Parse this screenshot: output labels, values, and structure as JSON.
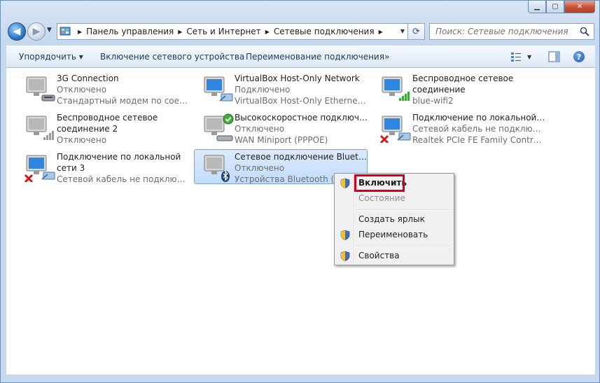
{
  "address": {
    "crumbs": [
      "Панель управления",
      "Сеть и Интернет",
      "Сетевые подключения"
    ]
  },
  "search": {
    "placeholder": "Поиск: Сетевые подключения"
  },
  "toolbar": {
    "organize": "Упорядочить ▾",
    "enable_device": "Включение сетевого устройства",
    "rename": "Переименование подключения",
    "more": "»"
  },
  "connections": [
    {
      "name": "3G Connection",
      "status": "Отключено",
      "device": "Стандартный модем по соедине..."
    },
    {
      "name": "VirtualBox Host-Only Network",
      "status": "Подключено",
      "device": "VirtualBox Host-Only Ethernet Ad..."
    },
    {
      "name": "Беспроводное сетевое соединение",
      "status": "",
      "device": "blue-wifi2"
    },
    {
      "name": "Беспроводное сетевое соединение 2",
      "status": "Отключено",
      "device": ""
    },
    {
      "name": "Высокоскоростное подключение",
      "status": "Отключено",
      "device": "WAN Miniport (PPPOE)"
    },
    {
      "name": "Подключение по локальной сети",
      "status": "Сетевой кабель не подключен",
      "device": "Realtek PCIe FE Family Controller"
    },
    {
      "name": "Подключение по локальной сети 3",
      "status": "",
      "device": "Сетевой кабель не подключен"
    },
    {
      "name": "Сетевое подключение Bluetooth",
      "status": "Отключено",
      "device": "Устройства Bluetooth (лич..."
    }
  ],
  "context_menu": {
    "enable": "Включить",
    "status": "Состояние",
    "create_shortcut": "Создать ярлык",
    "rename": "Переименовать",
    "properties": "Свойства"
  },
  "colors": {
    "highlight": "#d4001a",
    "selection": "#c1dcfc",
    "link": "#1e395b"
  }
}
